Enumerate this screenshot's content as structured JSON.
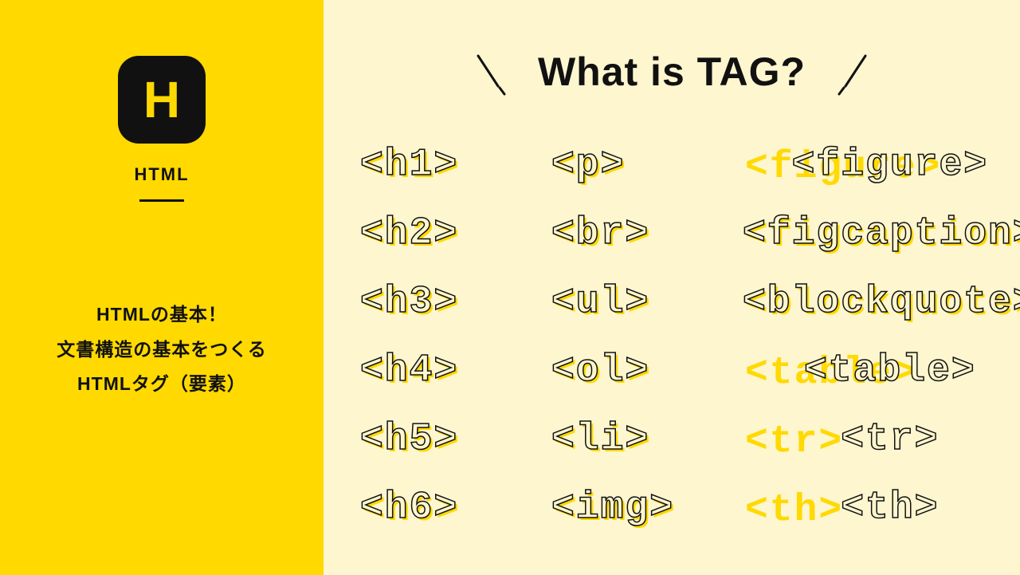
{
  "sidebar": {
    "icon_letter": "H",
    "label": "HTML",
    "desc_line1": "HTMLの基本！",
    "desc_line2": "文書構造の基本をつくる",
    "desc_line3": "HTMLタグ（要素）"
  },
  "main": {
    "heading": "What is TAG?",
    "tags": {
      "col1": [
        "<h1>",
        "<h2>",
        "<h3>",
        "<h4>",
        "<h5>",
        "<h6>"
      ],
      "col2": [
        "<p>",
        "<br>",
        "<ul>",
        "<ol>",
        "<li>",
        "<img>"
      ],
      "col3": [
        "<figure>",
        "<figcaption>",
        "<blockquote>",
        "<table>",
        "<tr>",
        "<th>"
      ]
    }
  }
}
